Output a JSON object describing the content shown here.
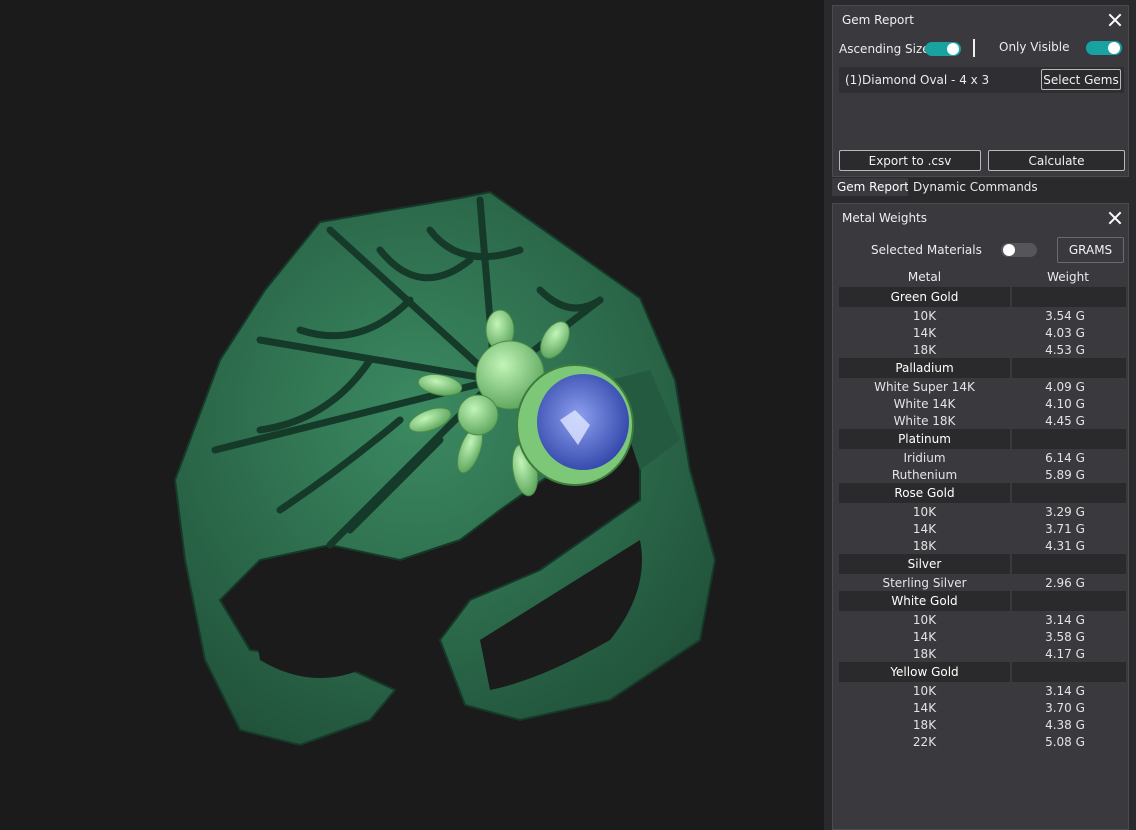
{
  "gem_report": {
    "title": "Gem Report",
    "ascending_size_label": "Ascending Size",
    "only_visible_label": "Only Visible",
    "gem_item": "(1)Diamond Oval - 4 x 3",
    "select_gems_label": "Select Gems",
    "export_label": "Export to .csv",
    "calculate_label": "Calculate"
  },
  "tabs": [
    {
      "label": "Gem Report",
      "active": true
    },
    {
      "label": "Dynamic Commands",
      "active": false
    }
  ],
  "metal_weights": {
    "title": "Metal Weights",
    "selected_materials_label": "Selected Materials",
    "selected_materials_on": false,
    "unit_button": "GRAMS",
    "col_metal": "Metal",
    "col_weight": "Weight",
    "groups": [
      {
        "name": "Green Gold",
        "rows": [
          {
            "metal": "10K",
            "weight": "3.54 G"
          },
          {
            "metal": "14K",
            "weight": "4.03 G"
          },
          {
            "metal": "18K",
            "weight": "4.53 G"
          }
        ]
      },
      {
        "name": "Palladium",
        "rows": [
          {
            "metal": "White Super 14K",
            "weight": "4.09 G"
          },
          {
            "metal": "White 14K",
            "weight": "4.10 G"
          },
          {
            "metal": "White 18K",
            "weight": "4.45 G"
          }
        ]
      },
      {
        "name": "Platinum",
        "rows": [
          {
            "metal": "Iridium",
            "weight": "6.14 G"
          },
          {
            "metal": "Ruthenium",
            "weight": "5.89 G"
          }
        ]
      },
      {
        "name": "Rose Gold",
        "rows": [
          {
            "metal": "10K",
            "weight": "3.29 G"
          },
          {
            "metal": "14K",
            "weight": "3.71 G"
          },
          {
            "metal": "18K",
            "weight": "4.31 G"
          }
        ]
      },
      {
        "name": "Silver",
        "rows": [
          {
            "metal": "Sterling Silver",
            "weight": "2.96 G"
          }
        ]
      },
      {
        "name": "White Gold",
        "rows": [
          {
            "metal": "10K",
            "weight": "3.14 G"
          },
          {
            "metal": "14K",
            "weight": "3.58 G"
          },
          {
            "metal": "18K",
            "weight": "4.17 G"
          }
        ]
      },
      {
        "name": "Yellow Gold",
        "rows": [
          {
            "metal": "10K",
            "weight": "3.14 G"
          },
          {
            "metal": "14K",
            "weight": "3.70 G"
          },
          {
            "metal": "18K",
            "weight": "4.38 G"
          },
          {
            "metal": "22K",
            "weight": "5.08 G"
          }
        ]
      }
    ]
  },
  "colors": {
    "accent_toggle": "#19a3a0",
    "ring_green": "#2e7050",
    "spider_green": "#8ed88a",
    "gem_blue": "#4b62c8"
  }
}
